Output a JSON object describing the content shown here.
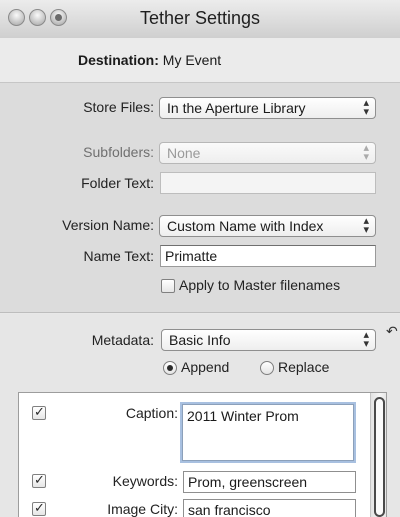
{
  "window": {
    "title": "Tether Settings"
  },
  "destination": {
    "label": "Destination:",
    "value": "My Event"
  },
  "store_files": {
    "label": "Store Files:",
    "value": "In the Aperture Library"
  },
  "subfolders": {
    "label": "Subfolders:",
    "value": "None"
  },
  "folder_text": {
    "label": "Folder Text:",
    "value": ""
  },
  "version_name": {
    "label": "Version Name:",
    "value": "Custom Name with Index"
  },
  "name_text": {
    "label": "Name Text:",
    "value": "Primatte"
  },
  "apply_master": {
    "label": "Apply to Master filenames",
    "checked": false
  },
  "metadata": {
    "label": "Metadata:",
    "value": "Basic Info",
    "append_label": "Append",
    "replace_label": "Replace",
    "mode": "append"
  },
  "fields": [
    {
      "label": "Caption:",
      "value": "2011 Winter Prom",
      "checked": true
    },
    {
      "label": "Keywords:",
      "value": "Prom, greenscreen",
      "checked": true
    },
    {
      "label": "Image City:",
      "value": "san francisco",
      "checked": true
    }
  ],
  "icons": {
    "revert": "revert-arrow-icon",
    "popup": "up-down-arrows-icon"
  }
}
